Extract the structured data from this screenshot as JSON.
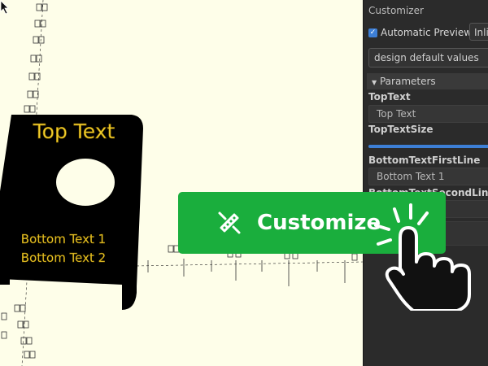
{
  "model": {
    "top_text": "Top Text",
    "bottom_line_1": "Bottom Text 1",
    "bottom_line_2": "Bottom Text 2",
    "text_color": "#f2cf2e",
    "body_color": "#000000"
  },
  "customizer": {
    "title": "Customizer",
    "automatic_preview_label": "Automatic Preview",
    "automatic_preview_checked": true,
    "preview_mode": "Inli",
    "preset": "design default values",
    "section_label": "Parameters",
    "params": [
      {
        "label": "TopText",
        "value": "Top Text"
      },
      {
        "label": "TopTextSize",
        "value": ""
      },
      {
        "label": "BottomTextFirstLine",
        "value": "Bottom Text 1"
      },
      {
        "label": "BottomTextSecondLine",
        "value": ""
      }
    ]
  },
  "cta": {
    "label": "Customize",
    "color": "#1aae3d"
  },
  "icons": {
    "cursor": "arrow-cursor-icon",
    "cta_icon": "pencil-ruler-icon",
    "hand": "pointing-hand-icon"
  }
}
